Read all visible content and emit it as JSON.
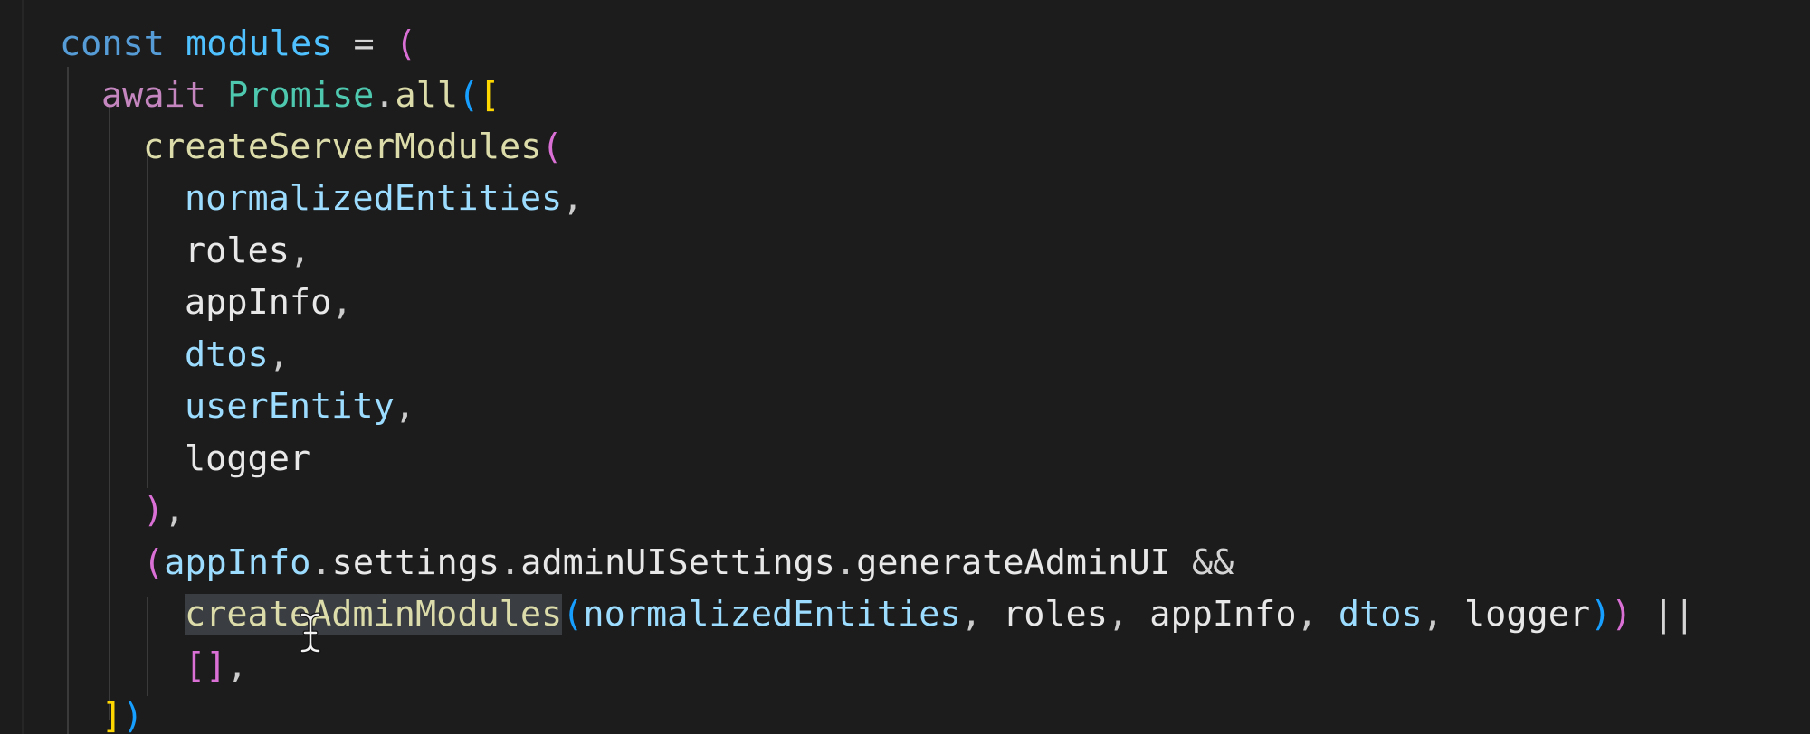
{
  "editor": {
    "language": "typescript",
    "theme_colors": {
      "background": "#1c1c1c",
      "keyword": "#569cd6",
      "control_keyword": "#c586c0",
      "constant": "#4fc1ff",
      "class": "#4ec9b0",
      "function": "#dcdcaa",
      "parameter": "#9cdcfe",
      "bracket_level_1": "#ffd700",
      "bracket_level_2": "#da70d6",
      "bracket_level_3": "#179fff"
    },
    "lines": [
      {
        "tokens": [
          {
            "text": "const",
            "role": "kw-storage"
          },
          {
            "text": " ",
            "role": "id"
          },
          {
            "text": "modules",
            "role": "var"
          },
          {
            "text": " = ",
            "role": "op"
          },
          {
            "text": "(",
            "role": "br-pink"
          }
        ]
      },
      {
        "tokens": [
          {
            "text": "await",
            "role": "kw-ctrl"
          },
          {
            "text": " ",
            "role": "id"
          },
          {
            "text": "Promise",
            "role": "cls"
          },
          {
            "text": ".",
            "role": "punct"
          },
          {
            "text": "all",
            "role": "fn"
          },
          {
            "text": "(",
            "role": "br-blue"
          },
          {
            "text": "[",
            "role": "br-gold"
          }
        ]
      },
      {
        "tokens": [
          {
            "text": "createServerModules",
            "role": "fn"
          },
          {
            "text": "(",
            "role": "br-pink"
          }
        ]
      },
      {
        "tokens": [
          {
            "text": "normalizedEntities",
            "role": "prm"
          },
          {
            "text": ",",
            "role": "punct"
          }
        ]
      },
      {
        "tokens": [
          {
            "text": "roles",
            "role": "id"
          },
          {
            "text": ",",
            "role": "punct"
          }
        ]
      },
      {
        "tokens": [
          {
            "text": "appInfo",
            "role": "id"
          },
          {
            "text": ",",
            "role": "punct"
          }
        ]
      },
      {
        "tokens": [
          {
            "text": "dtos",
            "role": "prm"
          },
          {
            "text": ",",
            "role": "punct"
          }
        ]
      },
      {
        "tokens": [
          {
            "text": "userEntity",
            "role": "prm"
          },
          {
            "text": ",",
            "role": "punct"
          }
        ]
      },
      {
        "tokens": [
          {
            "text": "logger",
            "role": "id"
          }
        ]
      },
      {
        "tokens": [
          {
            "text": ")",
            "role": "br-pink"
          },
          {
            "text": ",",
            "role": "punct"
          }
        ]
      },
      {
        "tokens": [
          {
            "text": "(",
            "role": "br-pink"
          },
          {
            "text": "appInfo",
            "role": "prm"
          },
          {
            "text": ".",
            "role": "punct"
          },
          {
            "text": "settings",
            "role": "id"
          },
          {
            "text": ".",
            "role": "punct"
          },
          {
            "text": "adminUISettings",
            "role": "id"
          },
          {
            "text": ".",
            "role": "punct"
          },
          {
            "text": "generateAdminUI",
            "role": "id"
          },
          {
            "text": " && ",
            "role": "op"
          }
        ]
      },
      {
        "tokens": [
          {
            "text": "createAdminModules",
            "role": "fn",
            "highlight": true
          },
          {
            "text": "(",
            "role": "br-blue"
          },
          {
            "text": "normalizedEntities",
            "role": "prm"
          },
          {
            "text": ", ",
            "role": "punct"
          },
          {
            "text": "roles",
            "role": "id"
          },
          {
            "text": ", ",
            "role": "punct"
          },
          {
            "text": "appInfo",
            "role": "id"
          },
          {
            "text": ", ",
            "role": "punct"
          },
          {
            "text": "dtos",
            "role": "prm"
          },
          {
            "text": ", ",
            "role": "punct"
          },
          {
            "text": "logger",
            "role": "id"
          },
          {
            "text": ")",
            "role": "br-blue"
          },
          {
            "text": ")",
            "role": "br-pink"
          },
          {
            "text": " ||",
            "role": "op"
          }
        ]
      },
      {
        "tokens": [
          {
            "text": "[]",
            "role": "br-pink"
          },
          {
            "text": ",",
            "role": "punct"
          }
        ]
      },
      {
        "tokens": [
          {
            "text": "]",
            "role": "br-gold"
          },
          {
            "text": ")",
            "role": "br-blue"
          }
        ]
      }
    ]
  },
  "pointer": {
    "icon": "text-cursor-icon"
  }
}
